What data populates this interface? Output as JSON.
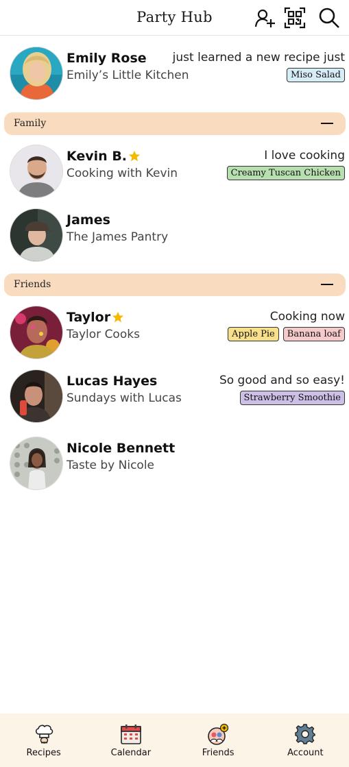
{
  "header": {
    "title": "Party Hub",
    "actions": [
      {
        "icon": "add-friend-icon"
      },
      {
        "icon": "qr-code-icon"
      },
      {
        "icon": "search-icon"
      }
    ]
  },
  "me": {
    "name": "Emily Rose",
    "subtitle": "Emily’s Little Kitchen",
    "status": "just learned a new recipe just",
    "tags": [
      {
        "label": "Miso Salad",
        "color": "#d6ecf7"
      }
    ]
  },
  "groups": [
    {
      "label": "Family",
      "collapse_icon": "minus-icon",
      "friends": [
        {
          "name": "Kevin B.",
          "starred": true,
          "subtitle": "Cooking with Kevin",
          "status": "I love cooking",
          "tags": [
            {
              "label": "Creamy Tuscan Chicken",
              "color": "#b7dfb0"
            }
          ]
        },
        {
          "name": "James",
          "starred": false,
          "subtitle": "The James Pantry",
          "status": "",
          "tags": []
        }
      ]
    },
    {
      "label": "Friends",
      "collapse_icon": "minus-icon",
      "friends": [
        {
          "name": "Taylor",
          "starred": true,
          "subtitle": "Taylor Cooks",
          "status": "Cooking now",
          "tags": [
            {
              "label": "Apple Pie",
              "color": "#f8df8a"
            },
            {
              "label": "Banana loaf",
              "color": "#f6c9cb"
            }
          ]
        },
        {
          "name": "Lucas Hayes",
          "starred": false,
          "subtitle": "Sundays with Lucas",
          "status": "So good and so easy!",
          "tags": [
            {
              "label": "Strawberry Smoothie",
              "color": "#cdbfe6"
            }
          ]
        },
        {
          "name": "Nicole Bennett",
          "starred": false,
          "subtitle": "Taste by Nicole",
          "status": "",
          "tags": []
        }
      ]
    }
  ],
  "tabbar": [
    {
      "label": "Recipes",
      "icon": "chef-hat-icon"
    },
    {
      "label": "Calendar",
      "icon": "calendar-icon"
    },
    {
      "label": "Friends",
      "icon": "friends-icon"
    },
    {
      "label": "Account",
      "icon": "gear-icon"
    }
  ],
  "colors": {
    "section_bg": "#f9dcbf",
    "tabbar_bg": "#fdf4e8",
    "star": "#f5b800"
  }
}
